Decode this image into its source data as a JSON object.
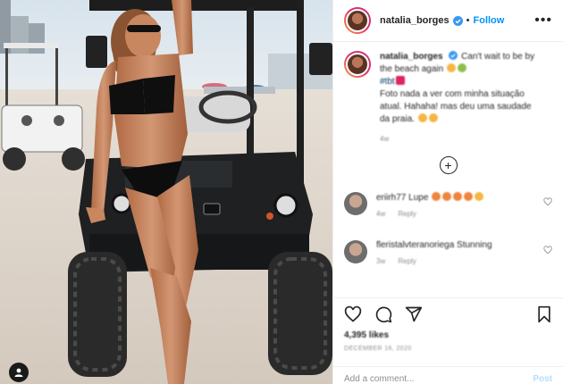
{
  "post": {
    "username": "natalia_borges",
    "follow_label": "Follow",
    "separator": "•",
    "more_label": "•••"
  },
  "caption": {
    "username": "natalia_borges",
    "text_line1": "Can't wait to be by",
    "text_line2": "the beach again",
    "hashtag": "#tbt",
    "text_line3": "Foto nada a ver com minha situação",
    "text_line4": "atual. Hahaha! mas deu uma saudade",
    "text_line5": "da praia.",
    "time": "4w"
  },
  "comments": [
    {
      "username": "eriirh77",
      "text": "Lupe",
      "time": "4w",
      "reply": "Reply"
    },
    {
      "username": "fleristalvteranoriega",
      "text": "Stunning",
      "time": "3w",
      "reply": "Reply"
    }
  ],
  "footer": {
    "likes": "4,395 likes",
    "date": "DECEMBER 16, 2020",
    "add_placeholder": "Add a comment...",
    "post_label": "Post"
  },
  "colors": {
    "link_blue": "#0095f6",
    "text": "#262626",
    "muted": "#8e8e8e",
    "post_disabled": "#b2dffc"
  }
}
